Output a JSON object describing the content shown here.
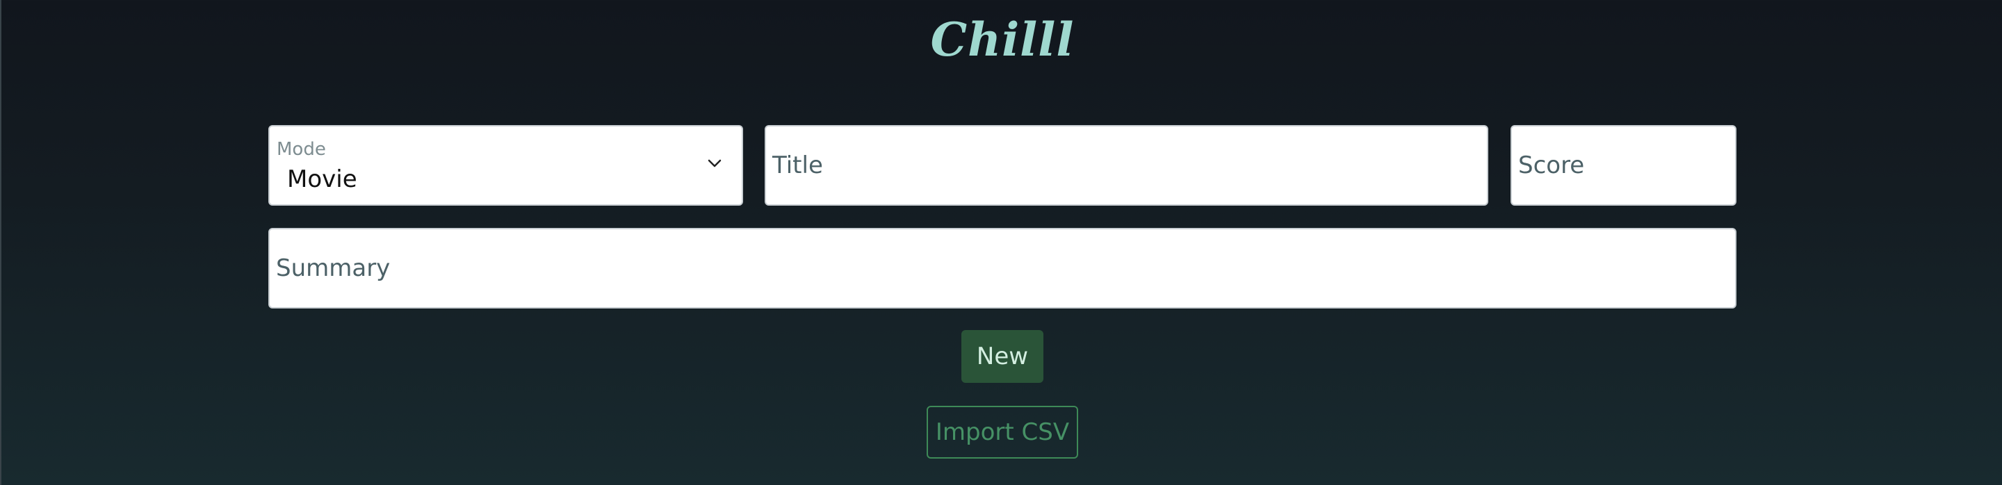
{
  "app": {
    "title": "Chilll"
  },
  "form": {
    "mode": {
      "label": "Mode",
      "value": "Movie"
    },
    "title": {
      "placeholder": "Title"
    },
    "score": {
      "placeholder": "Score"
    },
    "summary": {
      "placeholder": "Summary"
    }
  },
  "actions": {
    "new_label": "New",
    "import_label": "Import CSV"
  },
  "colors": {
    "logo": "#9fd8cf",
    "primary_button": "#2a5438",
    "outline_button": "#3e8a57",
    "background_top": "#11161d",
    "background_bottom": "#182a2f"
  }
}
